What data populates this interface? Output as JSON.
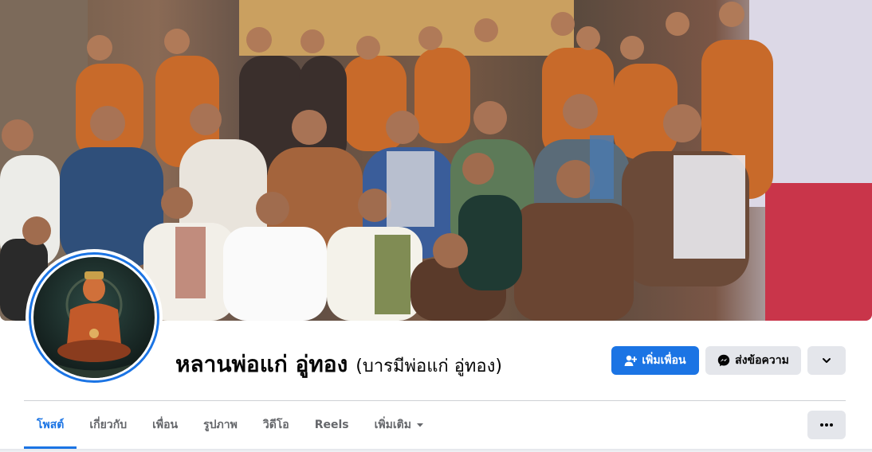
{
  "profile": {
    "name": "หลานพ่อแก่ อู่ทอง",
    "alternate_name": "(บารมีพ่อแก่ อู่ทอง)"
  },
  "actions": {
    "add_friend_label": "เพิ่มเพื่อน",
    "message_label": "ส่งข้อความ"
  },
  "tabs": [
    {
      "label": "โพสต์",
      "active": true
    },
    {
      "label": "เกี่ยวกับ",
      "active": false
    },
    {
      "label": "เพื่อน",
      "active": false
    },
    {
      "label": "รูปภาพ",
      "active": false
    },
    {
      "label": "วิดีโอ",
      "active": false
    },
    {
      "label": "Reels",
      "active": false
    },
    {
      "label": "เพิ่มเติม",
      "active": false
    }
  ],
  "colors": {
    "accent": "#1b74e4",
    "button_gray": "#e4e6eb",
    "text_secondary": "#65676b"
  },
  "icons": {
    "add_friend": "person-plus-icon",
    "messenger": "messenger-icon",
    "dropdown": "chevron-down-icon",
    "more": "ellipsis-icon"
  }
}
